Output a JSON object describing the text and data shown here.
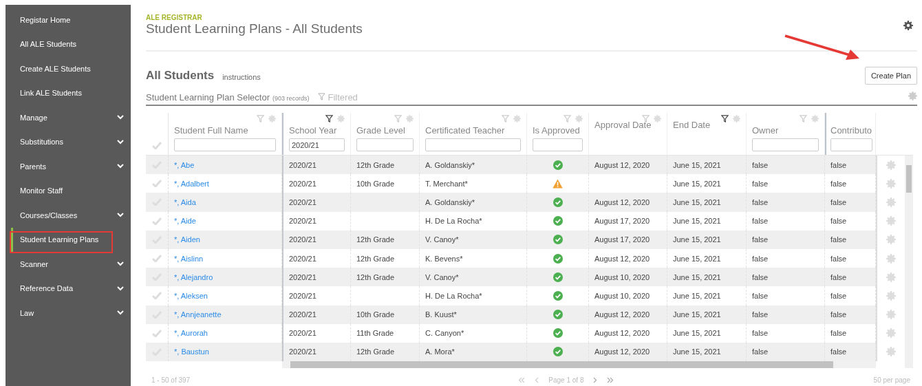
{
  "sidebar": {
    "items": [
      {
        "label": "Registar Home",
        "has_submenu": false,
        "selected": false,
        "annotated": false
      },
      {
        "label": "All ALE Students",
        "has_submenu": false,
        "selected": false,
        "annotated": false
      },
      {
        "label": "Create ALE Students",
        "has_submenu": false,
        "selected": false,
        "annotated": false
      },
      {
        "label": "Link ALE Students",
        "has_submenu": false,
        "selected": false,
        "annotated": false
      },
      {
        "label": "Manage",
        "has_submenu": true,
        "selected": false,
        "annotated": false
      },
      {
        "label": "Substitutions",
        "has_submenu": true,
        "selected": false,
        "annotated": false
      },
      {
        "label": "Parents",
        "has_submenu": true,
        "selected": false,
        "annotated": false
      },
      {
        "label": "Monitor Staff",
        "has_submenu": false,
        "selected": false,
        "annotated": false
      },
      {
        "label": "Courses/Classes",
        "has_submenu": true,
        "selected": false,
        "annotated": false
      },
      {
        "label": "Student Learning Plans",
        "has_submenu": false,
        "selected": true,
        "annotated": true
      },
      {
        "label": "Scanner",
        "has_submenu": true,
        "selected": false,
        "annotated": false
      },
      {
        "label": "Reference Data",
        "has_submenu": true,
        "selected": false,
        "annotated": false
      },
      {
        "label": "Law",
        "has_submenu": true,
        "selected": false,
        "annotated": false
      }
    ]
  },
  "header": {
    "app": "ALE REGISTRAR",
    "title": "Student Learning Plans - All Students"
  },
  "section": {
    "title": "All Students",
    "link": "instructions",
    "create_button": {
      "label": "Create Plan",
      "annotated": true
    }
  },
  "selector": {
    "title": "Student Learning Plan Selector",
    "count": "(903 records)",
    "filter_label": "Filtered"
  },
  "table": {
    "columns": [
      {
        "label": "Student Full Name",
        "filter_active": false,
        "filter_field": true
      },
      {
        "label": "School Year",
        "filter_active": true,
        "filter_field": true,
        "filter_value": "2020/21"
      },
      {
        "label": "Grade Level",
        "filter_active": false,
        "filter_field": true
      },
      {
        "label": "Certificated Teacher",
        "filter_active": false,
        "filter_field": true
      },
      {
        "label": "Is Approved",
        "filter_active": false,
        "filter_field": true
      },
      {
        "label": "Approval Date",
        "filter_active": false,
        "filter_field": false
      },
      {
        "label": "End Date",
        "filter_active": true,
        "filter_field": false
      },
      {
        "label": "Owner",
        "filter_active": false,
        "filter_field": true
      },
      {
        "label": "Contributo",
        "filter_field": true
      }
    ],
    "rows": [
      {
        "name": "*, Abe",
        "school_year": "2020/21",
        "grade_level": "12th Grade",
        "teacher": "A. Goldanskiy*",
        "approved": true,
        "approval_date": "August 12, 2020",
        "end_date": "June 15, 2021",
        "owner": "false",
        "contributor": "false"
      },
      {
        "name": "*, Adalbert",
        "school_year": "2020/21",
        "grade_level": "10th Grade",
        "teacher": "T. Merchant*",
        "approved": false,
        "end_date": "June 15, 2021",
        "owner": "false",
        "contributor": "false"
      },
      {
        "name": "*, Aida",
        "school_year": "2020/21",
        "teacher": "A. Goldanskiy*",
        "approved": true,
        "approval_date": "August 12, 2020",
        "end_date": "June 15, 2021",
        "owner": "false",
        "contributor": "false"
      },
      {
        "name": "*, Aide",
        "school_year": "2020/21",
        "teacher": "H. De La Rocha*",
        "approved": true,
        "approval_date": "August 17, 2020",
        "end_date": "June 15, 2021",
        "owner": "false",
        "contributor": "false"
      },
      {
        "name": "*, Aiden",
        "school_year": "2020/21",
        "grade_level": "12th Grade",
        "teacher": "V. Canoy*",
        "approved": true,
        "approval_date": "August 17, 2020",
        "end_date": "June 15, 2021",
        "owner": "false",
        "contributor": "false"
      },
      {
        "name": "*, Aislinn",
        "school_year": "2020/21",
        "grade_level": "12th Grade",
        "teacher": "K. Bevens*",
        "approved": true,
        "approval_date": "August 12, 2020",
        "end_date": "June 15, 2021",
        "owner": "false",
        "contributor": "false"
      },
      {
        "name": "*, Alejandro",
        "school_year": "2020/21",
        "grade_level": "12th Grade",
        "teacher": "V. Canoy*",
        "approved": true,
        "approval_date": "August 10, 2020",
        "end_date": "June 15, 2021",
        "owner": "false",
        "contributor": "false"
      },
      {
        "name": "*, Aleksen",
        "school_year": "2020/21",
        "teacher": "H. De La Rocha*",
        "approved": true,
        "approval_date": "August 10, 2020",
        "end_date": "June 15, 2021",
        "owner": "false",
        "contributor": "false"
      },
      {
        "name": "*, Annjeanette",
        "school_year": "2020/21",
        "grade_level": "10th Grade",
        "teacher": "B. Kuust*",
        "approved": true,
        "approval_date": "August 12, 2020",
        "end_date": "June 15, 2021",
        "owner": "false",
        "contributor": "false"
      },
      {
        "name": "*, Aurorah",
        "school_year": "2020/21",
        "grade_level": "11th Grade",
        "teacher": "C. Canyon*",
        "approved": true,
        "approval_date": "August 12, 2020",
        "end_date": "June 15, 2021",
        "owner": "false",
        "contributor": "false"
      },
      {
        "name": "*, Baustun",
        "school_year": "2020/21",
        "grade_level": "12th Grade",
        "teacher": "A. Mora*",
        "approved": true,
        "approval_date": "August 12, 2020",
        "end_date": "June 15, 2021",
        "owner": "false",
        "contributor": "false"
      }
    ]
  },
  "pager": {
    "range": "1 - 50 of 397",
    "page": "Page 1 of 8",
    "per_page": "50 per page"
  }
}
